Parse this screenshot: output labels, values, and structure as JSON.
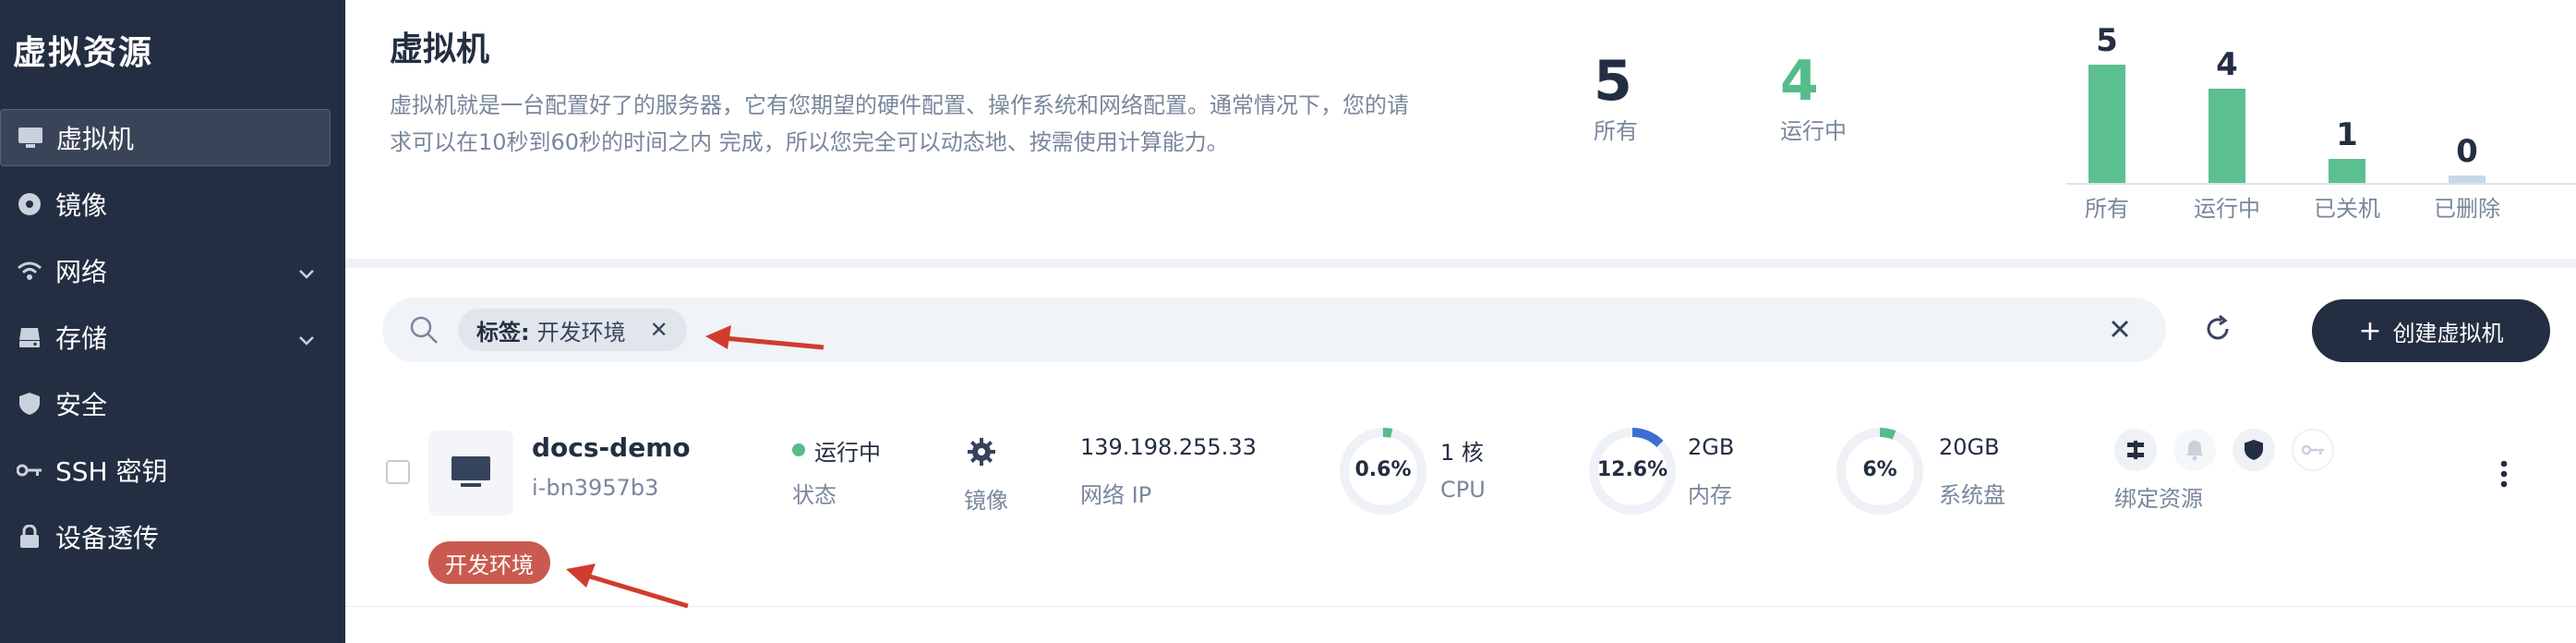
{
  "sidebar": {
    "title": "虚拟资源",
    "items": [
      {
        "label": "虚拟机",
        "icon": "monitor-icon",
        "active": true
      },
      {
        "label": "镜像",
        "icon": "disc-icon"
      },
      {
        "label": "网络",
        "icon": "wifi-icon",
        "expandable": true
      },
      {
        "label": "存储",
        "icon": "hard-drive-icon",
        "expandable": true
      },
      {
        "label": "安全",
        "icon": "shield-icon"
      },
      {
        "label": "SSH 密钥",
        "icon": "key-icon"
      },
      {
        "label": "设备透传",
        "icon": "lock-icon"
      }
    ]
  },
  "header": {
    "title": "虚拟机",
    "description": "虚拟机就是一台配置好了的服务器，它有您期望的硬件配置、操作系统和网络配置。通常情况下，您的请求可以在10秒到60秒的时间之内 完成，所以您完全可以动态地、按需使用计算能力。"
  },
  "stats": {
    "all": {
      "value": "5",
      "label": "所有"
    },
    "running": {
      "value": "4",
      "label": "运行中"
    }
  },
  "chart_data": {
    "type": "bar",
    "categories": [
      "所有",
      "运行中",
      "已关机",
      "已删除"
    ],
    "values": [
      5,
      4,
      1,
      0
    ],
    "colors": [
      "#5cbf8f",
      "#5cbf8f",
      "#5cbf8f",
      "#c7d7e6"
    ]
  },
  "toolbar": {
    "filter_tag_key": "标签:",
    "filter_tag_value": "开发环境",
    "create_label": "创建虚拟机"
  },
  "vm": {
    "name": "docs-demo",
    "id": "i-bn3957b3",
    "status": "运行中",
    "status_label": "状态",
    "image_label": "镜像",
    "ip": "139.198.255.33",
    "ip_label": "网络 IP",
    "cpu": {
      "usage": "0.6%",
      "fraction": 0.006,
      "value": "1 核",
      "label": "CPU"
    },
    "memory": {
      "usage": "12.6%",
      "fraction": 0.126,
      "value": "2GB",
      "label": "内存"
    },
    "disk": {
      "usage": "6%",
      "fraction": 0.06,
      "value": "20GB",
      "label": "系统盘"
    },
    "bind_label": "绑定资源",
    "tag": "开发环境"
  },
  "colors": {
    "accent": "#55bc8a",
    "dark": "#242e42",
    "tag_red": "#ca5a50",
    "memory_blue": "#3a6fd1",
    "annotation_arrow": "#d13b2e"
  }
}
